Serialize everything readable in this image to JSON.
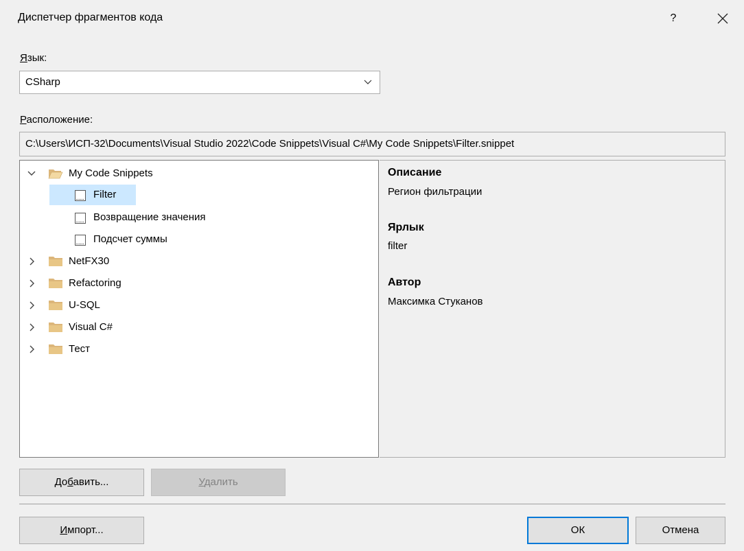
{
  "window": {
    "title": "Диспетчер фрагментов кода",
    "help": "?",
    "close": "✕"
  },
  "language": {
    "label_pre": "",
    "label_accel": "Я",
    "label_post": "зык:",
    "selected": "CSharp"
  },
  "location": {
    "label_accel": "Р",
    "label_post": "асположение:",
    "path": "C:\\Users\\ИСП-32\\Documents\\Visual Studio 2022\\Code Snippets\\Visual C#\\My Code Snippets\\Filter.snippet"
  },
  "tree": {
    "root": "My Code Snippets",
    "children": [
      "Filter",
      "Возвращение значения",
      "Подсчет суммы"
    ],
    "folders": [
      "NetFX30",
      "Refactoring",
      "U-SQL",
      "Visual C#",
      "Тест"
    ]
  },
  "details": {
    "description_label": "Описание",
    "description_value": "Регион фильтрации",
    "shortcut_label": "Ярлык",
    "shortcut_value": "filter",
    "author_label": "Автор",
    "author_value": "Максимка Стуканов"
  },
  "buttons": {
    "add_pre": "До",
    "add_accel": "б",
    "add_post": "авить...",
    "remove_accel": "У",
    "remove_post": "далить",
    "import_accel": "И",
    "import_post": "мпорт...",
    "ok": "ОК",
    "cancel": "Отмена"
  },
  "colors": {
    "selection": "#cce8ff",
    "folder": "#dcb67a",
    "accent": "#0078d7"
  }
}
